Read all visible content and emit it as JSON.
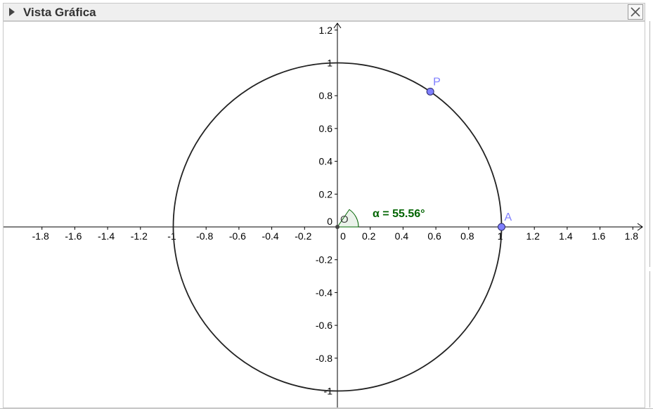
{
  "window": {
    "title": "Vista Gráfica",
    "close_label": "×"
  },
  "graph": {
    "x_ticks": [
      "-1.8",
      "-1.6",
      "-1.4",
      "-1.2",
      "-1",
      "-0.8",
      "-0.6",
      "-0.4",
      "-0.2",
      "0",
      "0.2",
      "0.4",
      "0.6",
      "0.8",
      "1",
      "1.2",
      "1.4",
      "1.6",
      "1.8"
    ],
    "y_ticks": [
      "1.2",
      "1",
      "0.8",
      "0.6",
      "0.4",
      "0.2",
      "0",
      "-0.2",
      "-0.4",
      "-0.6",
      "-0.8",
      "-1"
    ],
    "x_tick_values": [
      -1.8,
      -1.6,
      -1.4,
      -1.2,
      -1,
      -0.8,
      -0.6,
      -0.4,
      -0.2,
      0,
      0.2,
      0.4,
      0.6,
      0.8,
      1,
      1.2,
      1.4,
      1.6,
      1.8
    ],
    "y_tick_values": [
      1.2,
      1,
      0.8,
      0.6,
      0.4,
      0.2,
      0,
      -0.2,
      -0.4,
      -0.6,
      -0.8,
      -1
    ],
    "circle": {
      "center_x": 0,
      "center_y": 0,
      "radius": 1
    },
    "points": [
      {
        "label": "P",
        "x": 0.566,
        "y": 0.825,
        "color": "#7f7fff"
      },
      {
        "label": "A",
        "x": 1,
        "y": 0,
        "color": "#7f7fff"
      }
    ],
    "origin_label": "O",
    "angle": {
      "label": "α = 55.56°",
      "degrees": 55.56,
      "color": "#006400"
    }
  }
}
